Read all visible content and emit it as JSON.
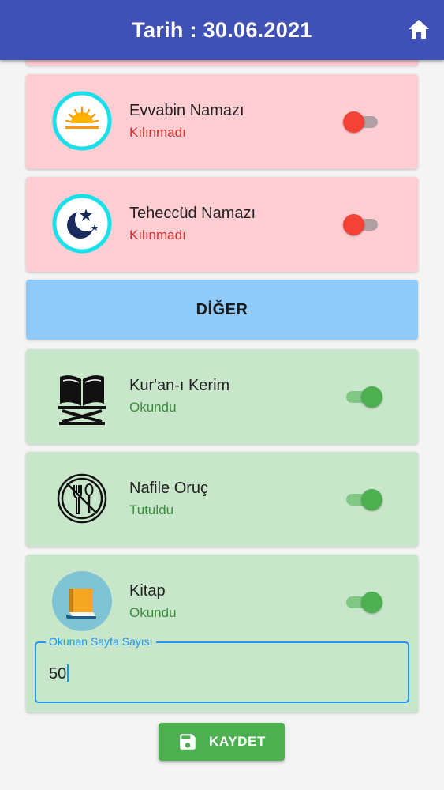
{
  "appbar": {
    "title": "Tarih : 30.06.2021",
    "home_icon": "home-icon"
  },
  "colors": {
    "appbar": "#3f51b5",
    "not_done_card": "#ffcdd2",
    "done_card": "#c8e6c9",
    "section_header": "#90caf9",
    "toggle_off": "#f44336",
    "toggle_on": "#4caf50",
    "accent": "#2196f3"
  },
  "items": [
    {
      "title": "Evvabin Namazı",
      "status": "Kılınmadı",
      "checked": false,
      "icon": "sunrise-icon"
    },
    {
      "title": "Teheccüd Namazı",
      "status": "Kılınmadı",
      "checked": false,
      "icon": "moon-stars-icon"
    },
    {
      "title": "Kur'an-ı Kerim",
      "status": "Okundu",
      "checked": true,
      "icon": "quran-icon"
    },
    {
      "title": "Nafile Oruç",
      "status": "Tutuldu",
      "checked": true,
      "icon": "no-eating-icon"
    },
    {
      "title": "Kitap",
      "status": "Okundu",
      "checked": true,
      "icon": "book-icon"
    }
  ],
  "section": {
    "title": "DİĞER"
  },
  "page_field": {
    "label": "Okunan Sayfa Sayısı",
    "value": "50"
  },
  "save_button": {
    "label": "KAYDET",
    "icon": "save-icon"
  }
}
